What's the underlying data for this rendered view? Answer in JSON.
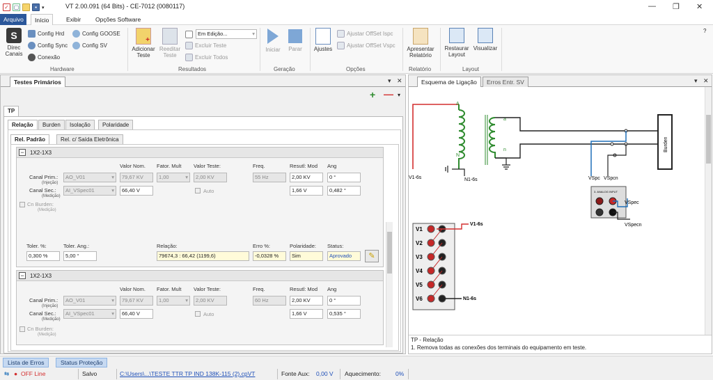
{
  "window": {
    "title": "VT 2.00.091 (64 Bits)  -  CE-7012 (0080117)"
  },
  "menu": {
    "items": [
      "Arquivo",
      "Início",
      "Exibir",
      "Opções Software"
    ]
  },
  "ribbon": {
    "hardware": {
      "title": "Hardware",
      "direc": "Direc\nCanais",
      "config_hrd": "Config Hrd",
      "config_goose": "Config GOOSE",
      "config_sync": "Config Sync",
      "config_sv": "Config SV",
      "conexao": "Conexão"
    },
    "resultados": {
      "title": "Resultados",
      "adicionar": "Adicionar\nTeste",
      "reeditar": "Reeditar\nTeste",
      "dropdown": "Em Edição...",
      "excluir_teste": "Excluir Teste",
      "excluir_todos": "Excluir Todos"
    },
    "geracao": {
      "title": "Geração",
      "iniciar": "Iniciar",
      "parar": "Parar"
    },
    "opcoes": {
      "title": "Opções",
      "ajustes": "Ajustes",
      "offset_ispc": "Ajustar OffSet Ispc",
      "offset_vspc": "Ajustar OffSet Vspc"
    },
    "relatorio": {
      "title": "Relatório",
      "apresentar": "Apresentar\nRelatório"
    },
    "layout": {
      "title": "Layout",
      "restaurar": "Restaurar\nLayout",
      "visualizar": "Visualizar"
    }
  },
  "left": {
    "panel_tab": "Testes Primários",
    "tp_tab": "TP",
    "subtabs": [
      "Relação",
      "Burden",
      "Isolação",
      "Polaridade"
    ],
    "subsubtabs": [
      "Rel. Padrão",
      "Rel. c/ Saída Eletrônica"
    ],
    "labels": {
      "valor_nom": "Valor Nom.",
      "fator_mult": "Fator. Mult",
      "valor_teste": "Valor Teste:",
      "freq": "Freq.",
      "resutl_mod": "Resutl: Mod",
      "ang": "Ang",
      "canal_prim": "Canal Prim.:",
      "injecao": "(Injeção)",
      "canal_sec": "Canal Sec.:",
      "medicao": "(Medição)",
      "cn_burden": "Cn Burden:",
      "auto": "Auto",
      "toler_pct": "Toler. %:",
      "toler_ang": "Toler. Ang.:",
      "relacao": "Relação:",
      "erro": "Erro %:",
      "polaridade": "Polaridade:",
      "status": "Status:"
    },
    "block1": {
      "name": "1X2-1X3",
      "canal_prim": "AO_V01",
      "canal_sec": "AI_VSpec01",
      "valor_nom_prim": "79,67 KV",
      "valor_nom_sec": "66,40 V",
      "fator": "1,00",
      "valor_teste": "2,00 KV",
      "freq": "55 Hz",
      "mod_prim": "2,00 KV",
      "mod_sec": "1,66 V",
      "ang_prim": "0 °",
      "ang_sec": "0,482 °",
      "toler_pct": "0,300 %",
      "toler_ang": "5,00 °",
      "relacao": "79674,3 : 66,42 (1199,6)",
      "erro": "-0,0328 %",
      "polaridade": "Sim",
      "status": "Aprovado"
    },
    "block2": {
      "name": "1X2-1X3",
      "canal_prim": "AO_V01",
      "canal_sec": "AI_VSpec01",
      "valor_nom_prim": "79,67 KV",
      "valor_nom_sec": "66,40 V",
      "fator": "1,00",
      "valor_teste": "2,00 KV",
      "freq": "60 Hz",
      "mod_prim": "2,00 KV",
      "mod_sec": "1,66 V",
      "ang_prim": "0 °",
      "ang_sec": "0,535 °"
    }
  },
  "right": {
    "tabs": [
      "Esquema de Ligação",
      "Erros Entr. SV"
    ],
    "diagram": {
      "A": "A",
      "N": "N",
      "a": "a",
      "n": "n",
      "burden": "Burden",
      "v16s": "V1-6s",
      "n16s": "N1-6s",
      "vspc": "VSpc",
      "vspcn": "VSpcn",
      "analog": "3. ANALOG INPUT",
      "vspec": "VSpec",
      "vspecn": "VSpecn",
      "outputs": [
        "V1",
        "V2",
        "V3",
        "V4",
        "V5",
        "V6"
      ],
      "out_v1": "V1-6s",
      "out_n1": "N1-6s"
    },
    "info": {
      "title": "TP - Relação",
      "text": "1. Remova todas as conexões dos terminais do equipamento em teste."
    }
  },
  "bottom": {
    "tabs": [
      "Lista de Erros",
      "Status Proteção"
    ]
  },
  "status": {
    "offline": "OFF Line",
    "salvo": "Salvo",
    "path": "C:\\Users\\...\\TESTE TTR TP IND 138K-115 (2).cpVT",
    "fonte_label": "Fonte Aux:",
    "fonte_val": "0,00 V",
    "aquec_label": "Aquecimento:",
    "aquec_val": "0%"
  },
  "colors": {
    "accent": "#2b579a",
    "red": "#d32f2f",
    "blue": "#1e6fb8",
    "green": "#2e8b2e"
  }
}
